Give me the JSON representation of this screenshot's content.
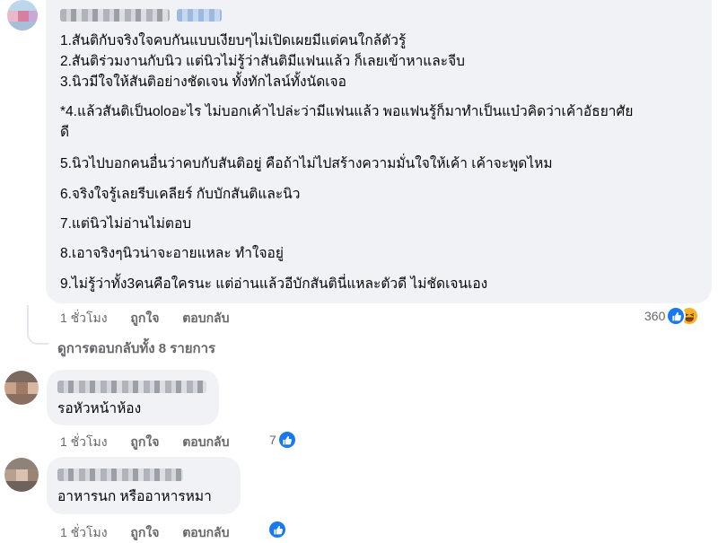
{
  "comment_main": {
    "lines": [
      "1.สันติกับจริงใจคบกันแบบเงียบๆไม่เปิดเผยมีแต่คนใกล้ตัวรู้",
      "2.สันติร่วมงานกับนิว แต่นิวไม่รู้ว่าสันติมีแฟนแล้ว ก็เลยเข้าหาและจีบ",
      "3.นิวมีใจให้สันติอย่างชัดเจน ทั้งทักไลน์ทั้งนัดเจอ",
      "*4.แล้วสันติเป็นoloอะไร ไม่บอกเค้าไปล่ะว่ามีแฟนแล้ว พอแฟนรู้ก็มาทำเป็นแบ๋วคิดว่าเค้าอัธยาศัย",
      "ดี",
      "5.นิวไปบอกคนอื่นว่าคบกับสันติอยู่ คือถ้าไม่ไปสร้างความมั่นใจให้เค้า เค้าจะพูดไหม",
      "6.จริงใจรู้เลยรีบเคลียร์ กับบักสันติและนิว",
      "7.แต่นิวไม่อ่านไม่ตอบ",
      "8.เอาจริงๆนิวน่าจะอายแหละ ทำใจอยู่",
      "9.ไม่รู้ว่าทั้ง3คนคือใครนะ แต่อ่านแล้วอีบักสันตินี่แหละตัวดี ไม่ชัดเจนเอง"
    ],
    "time": "1 ชั่วโมง",
    "like_label": "ถูกใจ",
    "reply_label": "ตอบกลับ",
    "reaction_count": "360",
    "reactions": [
      "like-icon",
      "haha-icon"
    ]
  },
  "view_replies_label": "ดูการตอบกลับทั้ง 8 รายการ",
  "reply_1": {
    "text": "รอหัวหน้าห้อง",
    "time": "1 ชั่วโมง",
    "like_label": "ถูกใจ",
    "reply_label": "ตอบกลับ",
    "reaction_count": "7",
    "reactions": [
      "like-icon"
    ]
  },
  "reply_2": {
    "text": "อาหารนก หรืออาหารหมา",
    "time": "1 ชั่วโมง",
    "like_label": "ถูกใจ",
    "reply_label": "ตอบกลับ",
    "reactions": [
      "like-icon"
    ]
  },
  "colors": {
    "bubble": "#f0f2f5",
    "meta_text": "#65676b",
    "like_blue": "#1877f2",
    "haha_yellow": "#f7b125"
  }
}
